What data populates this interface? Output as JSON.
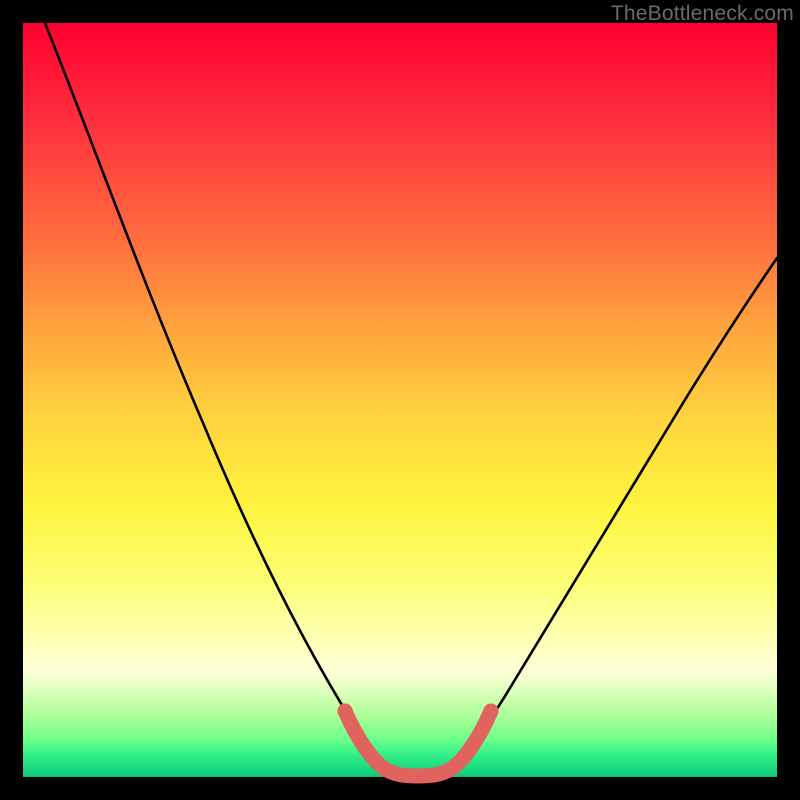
{
  "watermark": "TheBottleneck.com",
  "colors": {
    "frame": "#000000",
    "curve_stroke": "#000000",
    "highlight_stroke": "#e0645d",
    "gradient_top": "#ff0030",
    "gradient_bottom": "#10c878"
  },
  "chart_data": {
    "type": "line",
    "title": "",
    "xlabel": "",
    "ylabel": "",
    "xlim": [
      0,
      100
    ],
    "ylim": [
      0,
      100
    ],
    "grid": false,
    "legend": false,
    "annotations": [
      "TheBottleneck.com"
    ],
    "series": [
      {
        "name": "bottleneck-curve",
        "x": [
          3,
          6,
          9,
          12,
          15,
          18,
          21,
          24,
          27,
          30,
          33,
          36,
          39,
          42,
          45,
          47,
          50,
          53,
          55,
          60,
          65,
          70,
          75,
          80,
          85,
          90,
          95,
          100
        ],
        "values": [
          100,
          92,
          84,
          76,
          68,
          60,
          52,
          45,
          38,
          32,
          26,
          20,
          14,
          8,
          3,
          1,
          0,
          0,
          1,
          4,
          9,
          16,
          24,
          32,
          41,
          50,
          58,
          66
        ]
      },
      {
        "name": "highlight-region",
        "x": [
          42,
          44,
          46,
          48,
          50,
          52,
          54,
          56
        ],
        "values": [
          8,
          4,
          1,
          0,
          0,
          0,
          1,
          4
        ]
      }
    ]
  }
}
